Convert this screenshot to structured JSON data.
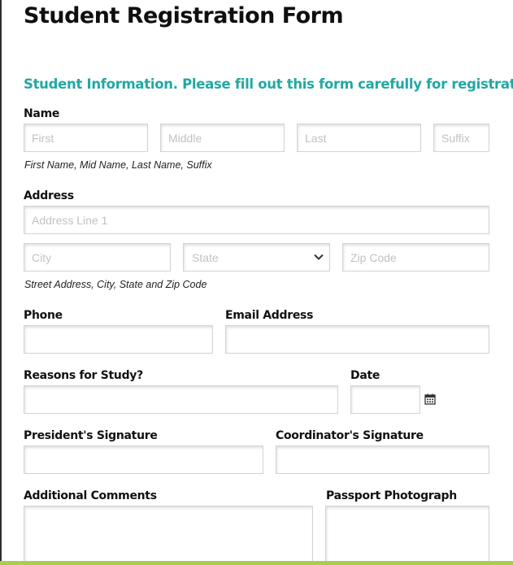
{
  "form": {
    "title": "Student Registration Form",
    "section_title": "Student Information. Please fill out this form carefully for registration"
  },
  "name": {
    "label": "Name",
    "first_placeholder": "First",
    "middle_placeholder": "Middle",
    "last_placeholder": "Last",
    "suffix_placeholder": "Suffix",
    "hint": "First Name, Mid Name, Last Name, Suffix"
  },
  "address": {
    "label": "Address",
    "line1_placeholder": "Address Line 1",
    "city_placeholder": "City",
    "state_placeholder": "State",
    "zip_placeholder": "Zip Code",
    "hint": "Street Address, City, State and Zip Code"
  },
  "phone": {
    "label": "Phone"
  },
  "email": {
    "label": "Email Address"
  },
  "reasons": {
    "label": "Reasons for Study?"
  },
  "date": {
    "label": "Date",
    "icon": "calendar-icon"
  },
  "president": {
    "label": "President's Signature"
  },
  "coordinator": {
    "label": "Coordinator's Signature"
  },
  "comments": {
    "label": "Additional Comments"
  },
  "photo": {
    "label": "Passport Photograph"
  },
  "colors": {
    "accent": "#22a8a3",
    "bottom_bar": "#a9cf4a",
    "placeholder": "#c2c2c2"
  }
}
